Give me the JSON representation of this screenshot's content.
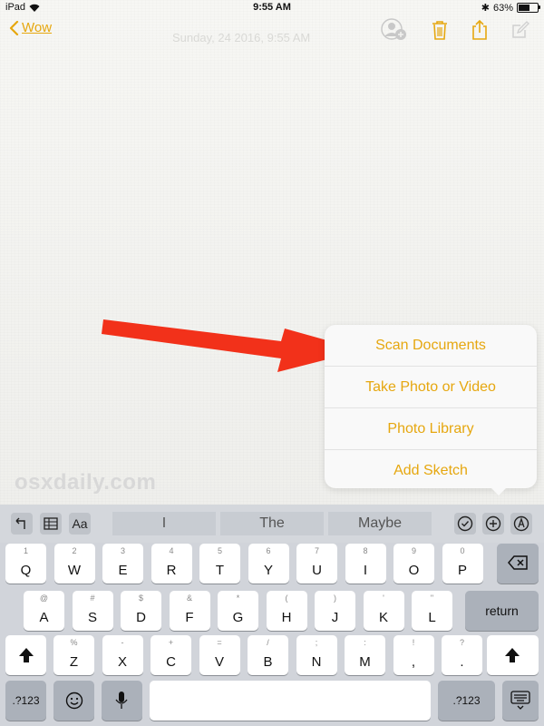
{
  "status": {
    "device": "iPad",
    "time": "9:55 AM",
    "battery": "63%"
  },
  "nav": {
    "back_label": "Wow"
  },
  "note": {
    "faded_title": "Sunday, 24 2016, 9:55 AM"
  },
  "menu": {
    "items": [
      "Scan Documents",
      "Take Photo or Video",
      "Photo Library",
      "Add Sketch"
    ]
  },
  "watermark": "osxdaily.com",
  "keyboard": {
    "suggestions": [
      "I",
      "The",
      "Maybe"
    ],
    "format_label": "Aa",
    "row1": [
      {
        "m": "Q",
        "s": "1"
      },
      {
        "m": "W",
        "s": "2"
      },
      {
        "m": "E",
        "s": "3"
      },
      {
        "m": "R",
        "s": "4"
      },
      {
        "m": "T",
        "s": "5"
      },
      {
        "m": "Y",
        "s": "6"
      },
      {
        "m": "U",
        "s": "7"
      },
      {
        "m": "I",
        "s": "8"
      },
      {
        "m": "O",
        "s": "9"
      },
      {
        "m": "P",
        "s": "0"
      }
    ],
    "row2": [
      {
        "m": "A",
        "s": "@"
      },
      {
        "m": "S",
        "s": "#"
      },
      {
        "m": "D",
        "s": "$"
      },
      {
        "m": "F",
        "s": "&"
      },
      {
        "m": "G",
        "s": "*"
      },
      {
        "m": "H",
        "s": "("
      },
      {
        "m": "J",
        "s": ")"
      },
      {
        "m": "K",
        "s": "'"
      },
      {
        "m": "L",
        "s": "\""
      }
    ],
    "row3": [
      {
        "m": "Z",
        "s": "%"
      },
      {
        "m": "X",
        "s": "-"
      },
      {
        "m": "C",
        "s": "+"
      },
      {
        "m": "V",
        "s": "="
      },
      {
        "m": "B",
        "s": "/"
      },
      {
        "m": "N",
        "s": ";"
      },
      {
        "m": "M",
        "s": ":"
      },
      {
        "m": ",",
        "s": "!"
      },
      {
        "m": ".",
        "s": "?"
      }
    ],
    "return_label": "return",
    "numbers_label": ".?123"
  }
}
